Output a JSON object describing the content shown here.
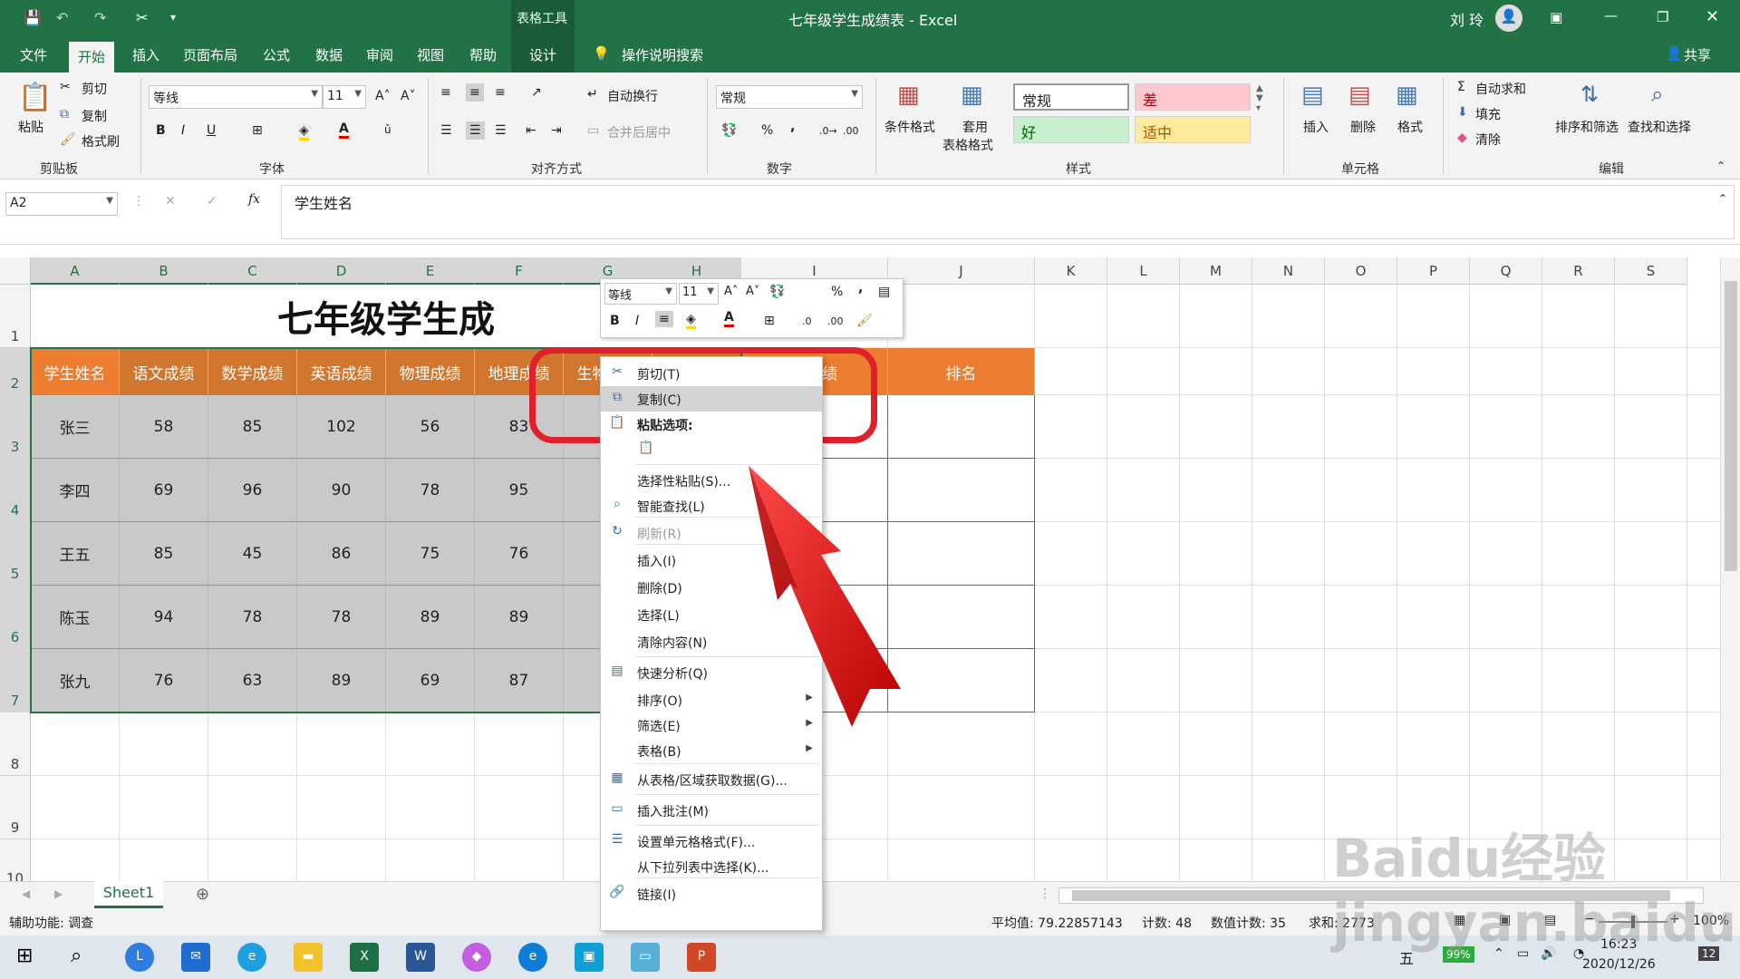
{
  "titlebar": {
    "context_tab": "表格工具",
    "title": "七年级学生成绩表 - Excel",
    "user": "刘 玲",
    "quick_access_more": "▾"
  },
  "tabs": [
    "文件",
    "开始",
    "插入",
    "页面布局",
    "公式",
    "数据",
    "审阅",
    "视图",
    "帮助",
    "设计"
  ],
  "active_tab": "开始",
  "tell_me": "操作说明搜索",
  "share": "共享",
  "ribbon": {
    "clipboard": {
      "paste": "粘贴",
      "cut": "剪切",
      "copy": "复制",
      "format_painter": "格式刷",
      "label": "剪贴板"
    },
    "font": {
      "name": "等线",
      "size": "11",
      "bold": "B",
      "italic": "I",
      "underline": "U",
      "label": "字体"
    },
    "alignment": {
      "wrap": "自动换行",
      "merge": "合并后居中",
      "label": "对齐方式"
    },
    "number": {
      "format": "常规",
      "percent": "%",
      "comma": ",",
      "label": "数字"
    },
    "styles": {
      "conditional": "条件格式",
      "table_format_1": "套用",
      "table_format_2": "表格格式",
      "normal": "常规",
      "bad": "差",
      "good": "好",
      "neutral": "适中",
      "label": "样式"
    },
    "cells": {
      "insert": "插入",
      "delete": "删除",
      "format": "格式",
      "label": "单元格"
    },
    "editing": {
      "autosum": "自动求和",
      "fill": "填充",
      "clear": "清除",
      "sort": "排序和筛选",
      "find": "查找和选择",
      "label": "编辑"
    }
  },
  "formula_bar": {
    "name_box": "A2",
    "fx": "fx",
    "content": "学生姓名"
  },
  "columns": [
    "A",
    "B",
    "C",
    "D",
    "E",
    "F",
    "G",
    "H",
    "I",
    "J",
    "K",
    "L",
    "M",
    "N",
    "O",
    "P",
    "Q",
    "R",
    "S"
  ],
  "rows": [
    "1",
    "2",
    "3",
    "4",
    "5",
    "6",
    "7",
    "8",
    "9",
    "10"
  ],
  "sheet": {
    "title": "七年级学生成",
    "headers": [
      "学生姓名",
      "语文成绩",
      "数学成绩",
      "英语成绩",
      "物理成绩",
      "地理成绩",
      "生物成绩",
      "历史成绩",
      "总成绩",
      "排名"
    ],
    "data": [
      [
        "张三",
        "58",
        "85",
        "102",
        "56",
        "83"
      ],
      [
        "李四",
        "69",
        "96",
        "90",
        "78",
        "95"
      ],
      [
        "王五",
        "85",
        "45",
        "86",
        "75",
        "76"
      ],
      [
        "陈玉",
        "94",
        "78",
        "78",
        "89",
        "89"
      ],
      [
        "张九",
        "76",
        "63",
        "89",
        "69",
        "87"
      ]
    ]
  },
  "mini_toolbar": {
    "font": "等线",
    "size": "11",
    "bold": "B",
    "italic": "I",
    "percent": "%",
    "comma": ","
  },
  "context_menu": [
    {
      "label": "剪切(T)",
      "icon": "scissors-icon",
      "glyph": "✂"
    },
    {
      "label": "复制(C)",
      "icon": "copy-icon",
      "glyph": "⧉",
      "highlight": true
    },
    {
      "label": "粘贴选项:",
      "icon": "paste-icon",
      "glyph": "📋",
      "bold": true
    },
    {
      "label": "",
      "icon": "paste-option-icon",
      "glyph": "📋"
    },
    {
      "label": "选择性粘贴(S)...",
      "icon": "",
      "glyph": ""
    },
    {
      "label": "智能查找(L)",
      "icon": "smart-lookup-icon",
      "glyph": "⌕"
    },
    {
      "label": "刷新(R)",
      "icon": "refresh-icon",
      "glyph": "↻",
      "disabled": true
    },
    {
      "label": "插入(I)",
      "icon": "",
      "glyph": ""
    },
    {
      "label": "删除(D)",
      "icon": "",
      "glyph": ""
    },
    {
      "label": "选择(L)",
      "icon": "",
      "glyph": ""
    },
    {
      "label": "清除内容(N)",
      "icon": "",
      "glyph": ""
    },
    {
      "label": "快速分析(Q)",
      "icon": "quick-analysis-icon",
      "glyph": "▤"
    },
    {
      "label": "排序(O)",
      "icon": "",
      "glyph": "",
      "submenu": true
    },
    {
      "label": "筛选(E)",
      "icon": "",
      "glyph": "",
      "submenu": true
    },
    {
      "label": "表格(B)",
      "icon": "",
      "glyph": "",
      "submenu": true
    },
    {
      "label": "从表格/区域获取数据(G)...",
      "icon": "table-icon",
      "glyph": "▦"
    },
    {
      "label": "插入批注(M)",
      "icon": "comment-icon",
      "glyph": "▭"
    },
    {
      "label": "设置单元格格式(F)...",
      "icon": "format-cells-icon",
      "glyph": "☰"
    },
    {
      "label": "从下拉列表中选择(K)...",
      "icon": "",
      "glyph": ""
    },
    {
      "label": "链接(I)",
      "icon": "link-icon",
      "glyph": "🔗"
    }
  ],
  "sheet_tab": "Sheet1",
  "status": {
    "accessibility": "辅助功能: 调查",
    "average": "平均值: 79.22857143",
    "count": "计数: 48",
    "numeric_count": "数值计数: 35",
    "sum": "求和: 2773",
    "zoom": "100%"
  },
  "taskbar": {
    "ime": "五",
    "battery": "99%",
    "time": "16:23",
    "date": "2020/12/26",
    "notifications": "12"
  },
  "watermark": "Baidu经验 jingyan.baidu.com",
  "colors": {
    "excel_green": "#217346",
    "header_orange": "#ed7d31",
    "highlight_red": "#e0323c"
  }
}
